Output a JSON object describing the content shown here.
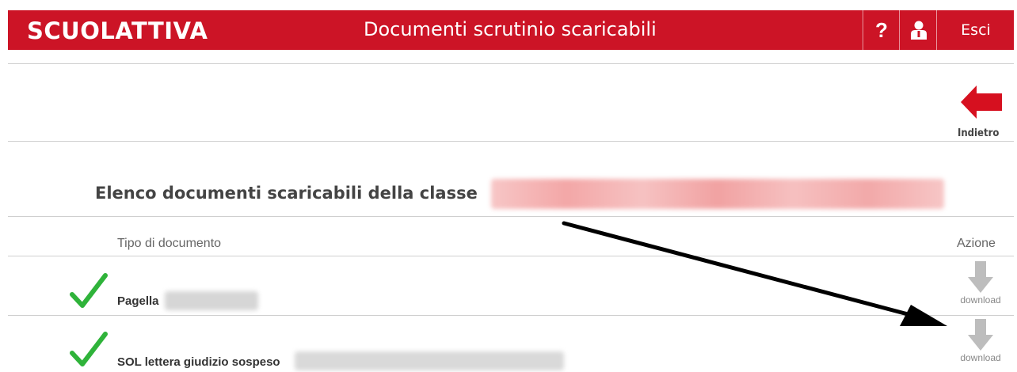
{
  "header": {
    "logo": "SCUOLATTIVA",
    "title": "Documenti scrutinio scaricabili",
    "help_label": "?",
    "exit_label": "Esci"
  },
  "back": {
    "label": "Indietro"
  },
  "heading": "Elenco documenti scaricabili della classe",
  "table": {
    "col_type": "Tipo di documento",
    "col_action": "Azione",
    "rows": [
      {
        "label": "Pagella",
        "action": "download"
      },
      {
        "label": "SOL lettera giudizio sospeso",
        "action": "download"
      }
    ]
  },
  "colors": {
    "header_bg": "#cc1426",
    "check": "#2fb33a",
    "back_arrow": "#d6101f",
    "download_arrow": "#bdbdbd"
  }
}
